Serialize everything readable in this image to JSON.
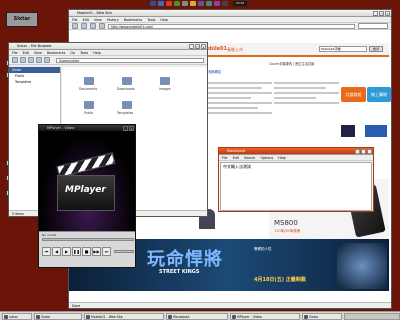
{
  "desktop": {
    "sidebar_label": "Sixtar"
  },
  "top_panel": {
    "clock": "08:56"
  },
  "browser": {
    "title": "Mobile01 - Web Site",
    "menu": [
      "File",
      "Edit",
      "View",
      "History",
      "Bookmarks",
      "Tools",
      "Help"
    ],
    "url": "http://www.mobile01.com/",
    "logo_text": "mobile01",
    "logo_subtitle": "春裝上市",
    "search_value": "Mobile01手機",
    "search_button": "搜尋",
    "banner_small": "免費相簿網站",
    "nav_text": "Clover手機專賣 | 數位生活討論",
    "side_button1": "討論群組",
    "side_button2": "線上購物",
    "ms800_title": "MS800",
    "ms800_sub": "120萬/60萬像素",
    "movie_title": "STREET KINGS",
    "movie_cjk": "玩命悍將",
    "movie_date": "4月18日(五) 正義制裁",
    "movie_tag": "警察的人性",
    "status": "Done"
  },
  "filemanager": {
    "title": "Sixtar - File Browser",
    "menu": [
      "File",
      "Edit",
      "View",
      "Bookmarks",
      "Go",
      "Tools",
      "Help"
    ],
    "path": "/home/sixtar",
    "sidebar_items": [
      "Sixtar",
      "Public",
      "Templates"
    ],
    "folders": [
      "Documents",
      "Downloads",
      "Images",
      "Public",
      "Templates"
    ],
    "status": "5 items"
  },
  "mplayer": {
    "title": "MPlayer - Video",
    "logo": "MPlayer",
    "status_label": "No media"
  },
  "textwin": {
    "title": "Mousepad",
    "menu": [
      "File",
      "Edit",
      "Search",
      "Options",
      "Help"
    ],
    "text": "中文輸入法測試"
  },
  "taskbar": {
    "items": [
      "sixtar",
      "Sixtar",
      "Mobile01 - Web Site",
      "Mousepad",
      "MPlayer - Video",
      "Sixtar"
    ]
  }
}
